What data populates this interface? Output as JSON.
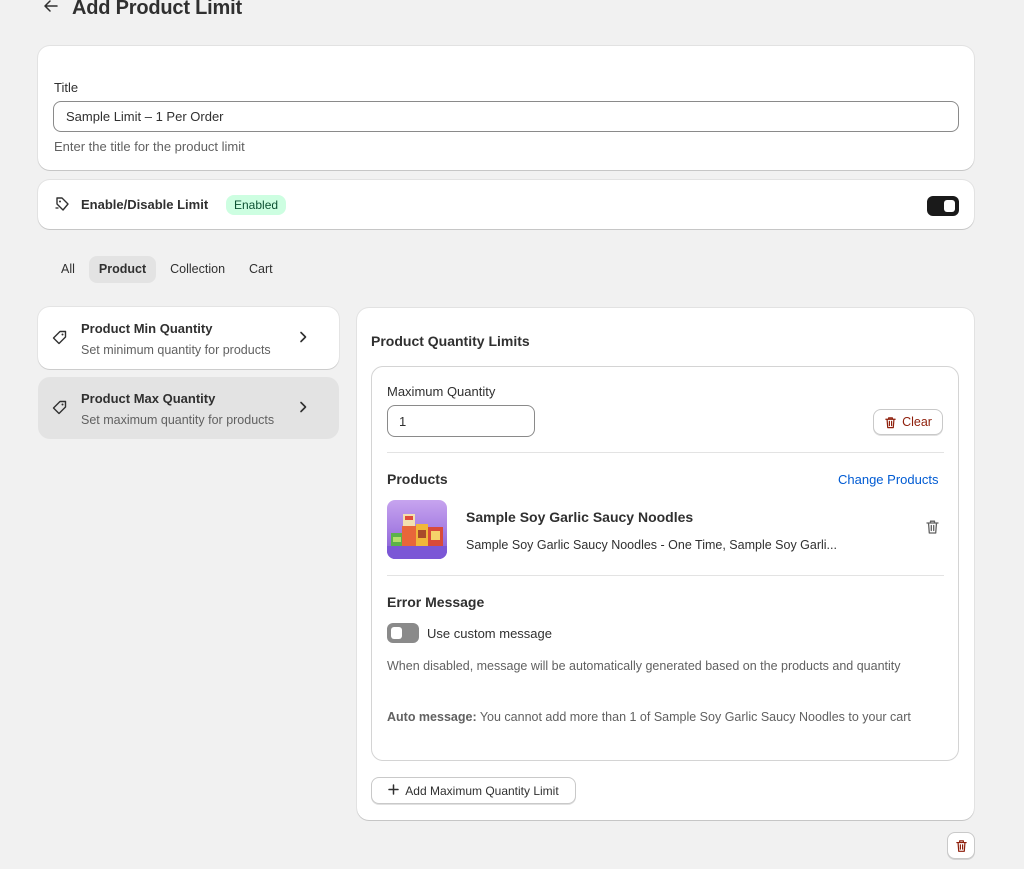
{
  "header": {
    "title": "Add Product Limit",
    "back_icon": "arrow-left-icon"
  },
  "title_card": {
    "label": "Title",
    "value": "Sample Limit – 1 Per Order",
    "help": "Enter the title for the product limit"
  },
  "enable_card": {
    "label": "Enable/Disable Limit",
    "badge": "Enabled",
    "enabled": true
  },
  "tabs": [
    {
      "label": "All",
      "active": false
    },
    {
      "label": "Product",
      "active": true
    },
    {
      "label": "Collection",
      "active": false
    },
    {
      "label": "Cart",
      "active": false
    }
  ],
  "nav": [
    {
      "title": "Product Min Quantity",
      "subtitle": "Set minimum quantity for products",
      "selected": false
    },
    {
      "title": "Product Max Quantity",
      "subtitle": "Set maximum quantity for products",
      "selected": true
    }
  ],
  "main": {
    "title": "Product Quantity Limits",
    "max_label": "Maximum Quantity",
    "max_value": "1",
    "clear_label": "Clear",
    "products_label": "Products",
    "change_products_label": "Change Products",
    "product": {
      "name": "Sample Soy Garlic Saucy Noodles",
      "variants": "Sample Soy Garlic Saucy Noodles - One Time, Sample Soy Garli..."
    },
    "error_label": "Error Message",
    "custom_message_label": "Use custom message",
    "custom_message_enabled": false,
    "help_text": "When disabled, message will be automatically generated based on the products and quantity",
    "auto_message_label": "Auto message:",
    "auto_message_text": " You cannot add more than 1 of Sample Soy Garlic Saucy Noodles to your cart",
    "add_button_label": "Add Maximum Quantity Limit"
  },
  "colors": {
    "accent_link": "#005bd3",
    "badge_bg": "#cdfee1",
    "badge_text": "#0c5132",
    "danger": "#8e1f0b"
  }
}
